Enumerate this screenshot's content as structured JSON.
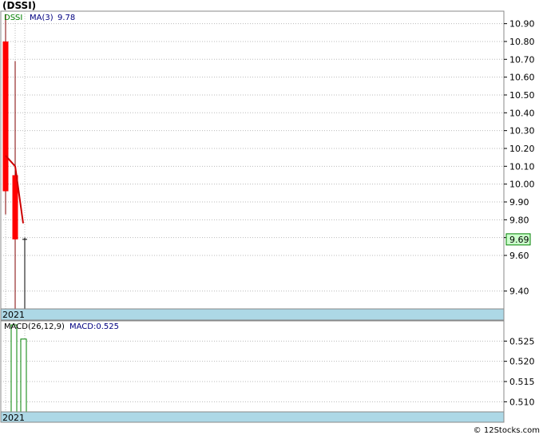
{
  "title": "(DSSI)",
  "credit": "© 12Stocks.com",
  "colors": {
    "down_candle": "#ff0000",
    "ma_line": "#cc0000",
    "macd_bar": "#008000",
    "price_badge_bg": "#ccffcc",
    "year_band": "#add8e6",
    "grid": "#bbbbbb"
  },
  "chart_data": [
    {
      "type": "candlestick",
      "legend": {
        "symbol": "DSSI",
        "ma_label": "MA(3)",
        "ma_value": "9.78"
      },
      "y_ticks": [
        "10.90",
        "10.80",
        "10.70",
        "10.60",
        "10.50",
        "10.40",
        "10.30",
        "10.20",
        "10.10",
        "10.00",
        "9.90",
        "9.80",
        "9.70",
        "9.60",
        "9.40"
      ],
      "ylim": [
        9.3,
        10.97
      ],
      "x_label": "2021",
      "current_price": "9.69",
      "candles": [
        {
          "open": 10.8,
          "close": 9.96,
          "high": 10.95,
          "low": 9.83,
          "color": "red"
        },
        {
          "open": 10.05,
          "close": 9.69,
          "high": 10.69,
          "low": 9.3,
          "color": "red"
        },
        {
          "open": 9.69,
          "close": 9.69,
          "high": 9.7,
          "low": 9.3,
          "color": "black"
        }
      ],
      "ma": [
        10.14,
        9.78
      ]
    },
    {
      "type": "bar",
      "legend": {
        "label": "MACD(26,12,9)",
        "value_label": "MACD:0.525"
      },
      "y_ticks": [
        "0.525",
        "0.520",
        "0.515",
        "0.510"
      ],
      "ylim": [
        0.5075,
        0.53
      ],
      "x_label": "2021",
      "values": [
        0.529,
        0.5255
      ]
    }
  ]
}
